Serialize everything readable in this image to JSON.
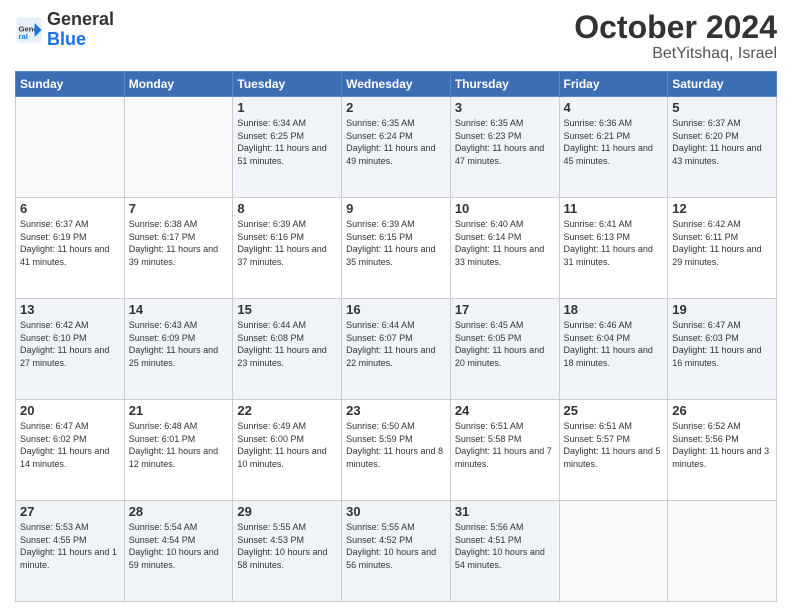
{
  "header": {
    "logo_general": "General",
    "logo_blue": "Blue",
    "month_title": "October 2024",
    "location": "BetYitshaq, Israel"
  },
  "days_of_week": [
    "Sunday",
    "Monday",
    "Tuesday",
    "Wednesday",
    "Thursday",
    "Friday",
    "Saturday"
  ],
  "weeks": [
    [
      {
        "day": "",
        "info": ""
      },
      {
        "day": "",
        "info": ""
      },
      {
        "day": "1",
        "info": "Sunrise: 6:34 AM\nSunset: 6:25 PM\nDaylight: 11 hours and 51 minutes."
      },
      {
        "day": "2",
        "info": "Sunrise: 6:35 AM\nSunset: 6:24 PM\nDaylight: 11 hours and 49 minutes."
      },
      {
        "day": "3",
        "info": "Sunrise: 6:35 AM\nSunset: 6:23 PM\nDaylight: 11 hours and 47 minutes."
      },
      {
        "day": "4",
        "info": "Sunrise: 6:36 AM\nSunset: 6:21 PM\nDaylight: 11 hours and 45 minutes."
      },
      {
        "day": "5",
        "info": "Sunrise: 6:37 AM\nSunset: 6:20 PM\nDaylight: 11 hours and 43 minutes."
      }
    ],
    [
      {
        "day": "6",
        "info": "Sunrise: 6:37 AM\nSunset: 6:19 PM\nDaylight: 11 hours and 41 minutes."
      },
      {
        "day": "7",
        "info": "Sunrise: 6:38 AM\nSunset: 6:17 PM\nDaylight: 11 hours and 39 minutes."
      },
      {
        "day": "8",
        "info": "Sunrise: 6:39 AM\nSunset: 6:16 PM\nDaylight: 11 hours and 37 minutes."
      },
      {
        "day": "9",
        "info": "Sunrise: 6:39 AM\nSunset: 6:15 PM\nDaylight: 11 hours and 35 minutes."
      },
      {
        "day": "10",
        "info": "Sunrise: 6:40 AM\nSunset: 6:14 PM\nDaylight: 11 hours and 33 minutes."
      },
      {
        "day": "11",
        "info": "Sunrise: 6:41 AM\nSunset: 6:13 PM\nDaylight: 11 hours and 31 minutes."
      },
      {
        "day": "12",
        "info": "Sunrise: 6:42 AM\nSunset: 6:11 PM\nDaylight: 11 hours and 29 minutes."
      }
    ],
    [
      {
        "day": "13",
        "info": "Sunrise: 6:42 AM\nSunset: 6:10 PM\nDaylight: 11 hours and 27 minutes."
      },
      {
        "day": "14",
        "info": "Sunrise: 6:43 AM\nSunset: 6:09 PM\nDaylight: 11 hours and 25 minutes."
      },
      {
        "day": "15",
        "info": "Sunrise: 6:44 AM\nSunset: 6:08 PM\nDaylight: 11 hours and 23 minutes."
      },
      {
        "day": "16",
        "info": "Sunrise: 6:44 AM\nSunset: 6:07 PM\nDaylight: 11 hours and 22 minutes."
      },
      {
        "day": "17",
        "info": "Sunrise: 6:45 AM\nSunset: 6:05 PM\nDaylight: 11 hours and 20 minutes."
      },
      {
        "day": "18",
        "info": "Sunrise: 6:46 AM\nSunset: 6:04 PM\nDaylight: 11 hours and 18 minutes."
      },
      {
        "day": "19",
        "info": "Sunrise: 6:47 AM\nSunset: 6:03 PM\nDaylight: 11 hours and 16 minutes."
      }
    ],
    [
      {
        "day": "20",
        "info": "Sunrise: 6:47 AM\nSunset: 6:02 PM\nDaylight: 11 hours and 14 minutes."
      },
      {
        "day": "21",
        "info": "Sunrise: 6:48 AM\nSunset: 6:01 PM\nDaylight: 11 hours and 12 minutes."
      },
      {
        "day": "22",
        "info": "Sunrise: 6:49 AM\nSunset: 6:00 PM\nDaylight: 11 hours and 10 minutes."
      },
      {
        "day": "23",
        "info": "Sunrise: 6:50 AM\nSunset: 5:59 PM\nDaylight: 11 hours and 8 minutes."
      },
      {
        "day": "24",
        "info": "Sunrise: 6:51 AM\nSunset: 5:58 PM\nDaylight: 11 hours and 7 minutes."
      },
      {
        "day": "25",
        "info": "Sunrise: 6:51 AM\nSunset: 5:57 PM\nDaylight: 11 hours and 5 minutes."
      },
      {
        "day": "26",
        "info": "Sunrise: 6:52 AM\nSunset: 5:56 PM\nDaylight: 11 hours and 3 minutes."
      }
    ],
    [
      {
        "day": "27",
        "info": "Sunrise: 5:53 AM\nSunset: 4:55 PM\nDaylight: 11 hours and 1 minute."
      },
      {
        "day": "28",
        "info": "Sunrise: 5:54 AM\nSunset: 4:54 PM\nDaylight: 10 hours and 59 minutes."
      },
      {
        "day": "29",
        "info": "Sunrise: 5:55 AM\nSunset: 4:53 PM\nDaylight: 10 hours and 58 minutes."
      },
      {
        "day": "30",
        "info": "Sunrise: 5:55 AM\nSunset: 4:52 PM\nDaylight: 10 hours and 56 minutes."
      },
      {
        "day": "31",
        "info": "Sunrise: 5:56 AM\nSunset: 4:51 PM\nDaylight: 10 hours and 54 minutes."
      },
      {
        "day": "",
        "info": ""
      },
      {
        "day": "",
        "info": ""
      }
    ]
  ]
}
